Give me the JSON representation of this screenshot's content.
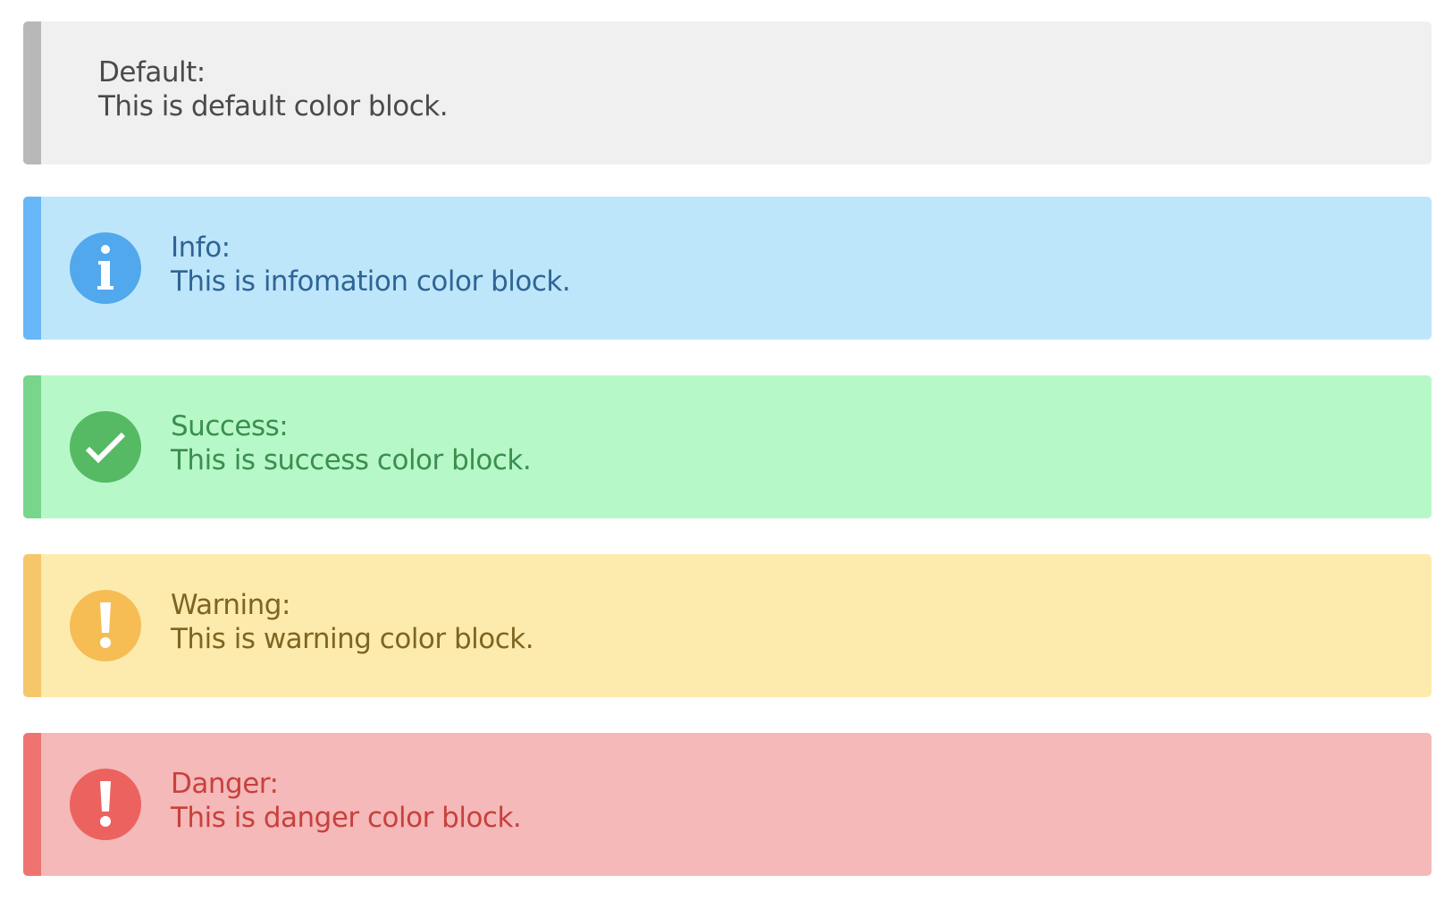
{
  "blocks": [
    {
      "id": "default",
      "title": "Default:",
      "message": "This is default color block.",
      "icon": null,
      "colors": {
        "bg": "#f0f0f0",
        "bar": "#b8b8b8",
        "text": "#4a4a4a"
      }
    },
    {
      "id": "info",
      "title": "Info:",
      "message": "This is infomation color block.",
      "icon": "info-icon",
      "colors": {
        "bg": "#bee6fa",
        "bar": "#68b7f8",
        "icon": "#52a8ec",
        "text": "#2f6496"
      }
    },
    {
      "id": "success",
      "title": "Success:",
      "message": "This is success color block.",
      "icon": "check-icon",
      "colors": {
        "bg": "#b7f8c8",
        "bar": "#77d68b",
        "icon": "#56b964",
        "text": "#3a8f4e"
      }
    },
    {
      "id": "warning",
      "title": "Warning:",
      "message": "This is warning color block.",
      "icon": "exclamation-icon",
      "colors": {
        "bg": "#fdebae",
        "bar": "#f5c76a",
        "icon": "#f6bd55",
        "text": "#7f6521"
      }
    },
    {
      "id": "danger",
      "title": "Danger:",
      "message": "This is danger color block.",
      "icon": "exclamation-icon",
      "colors": {
        "bg": "#f4b9b8",
        "bar": "#ef7471",
        "icon": "#ec625f",
        "text": "#c9403d"
      }
    }
  ]
}
